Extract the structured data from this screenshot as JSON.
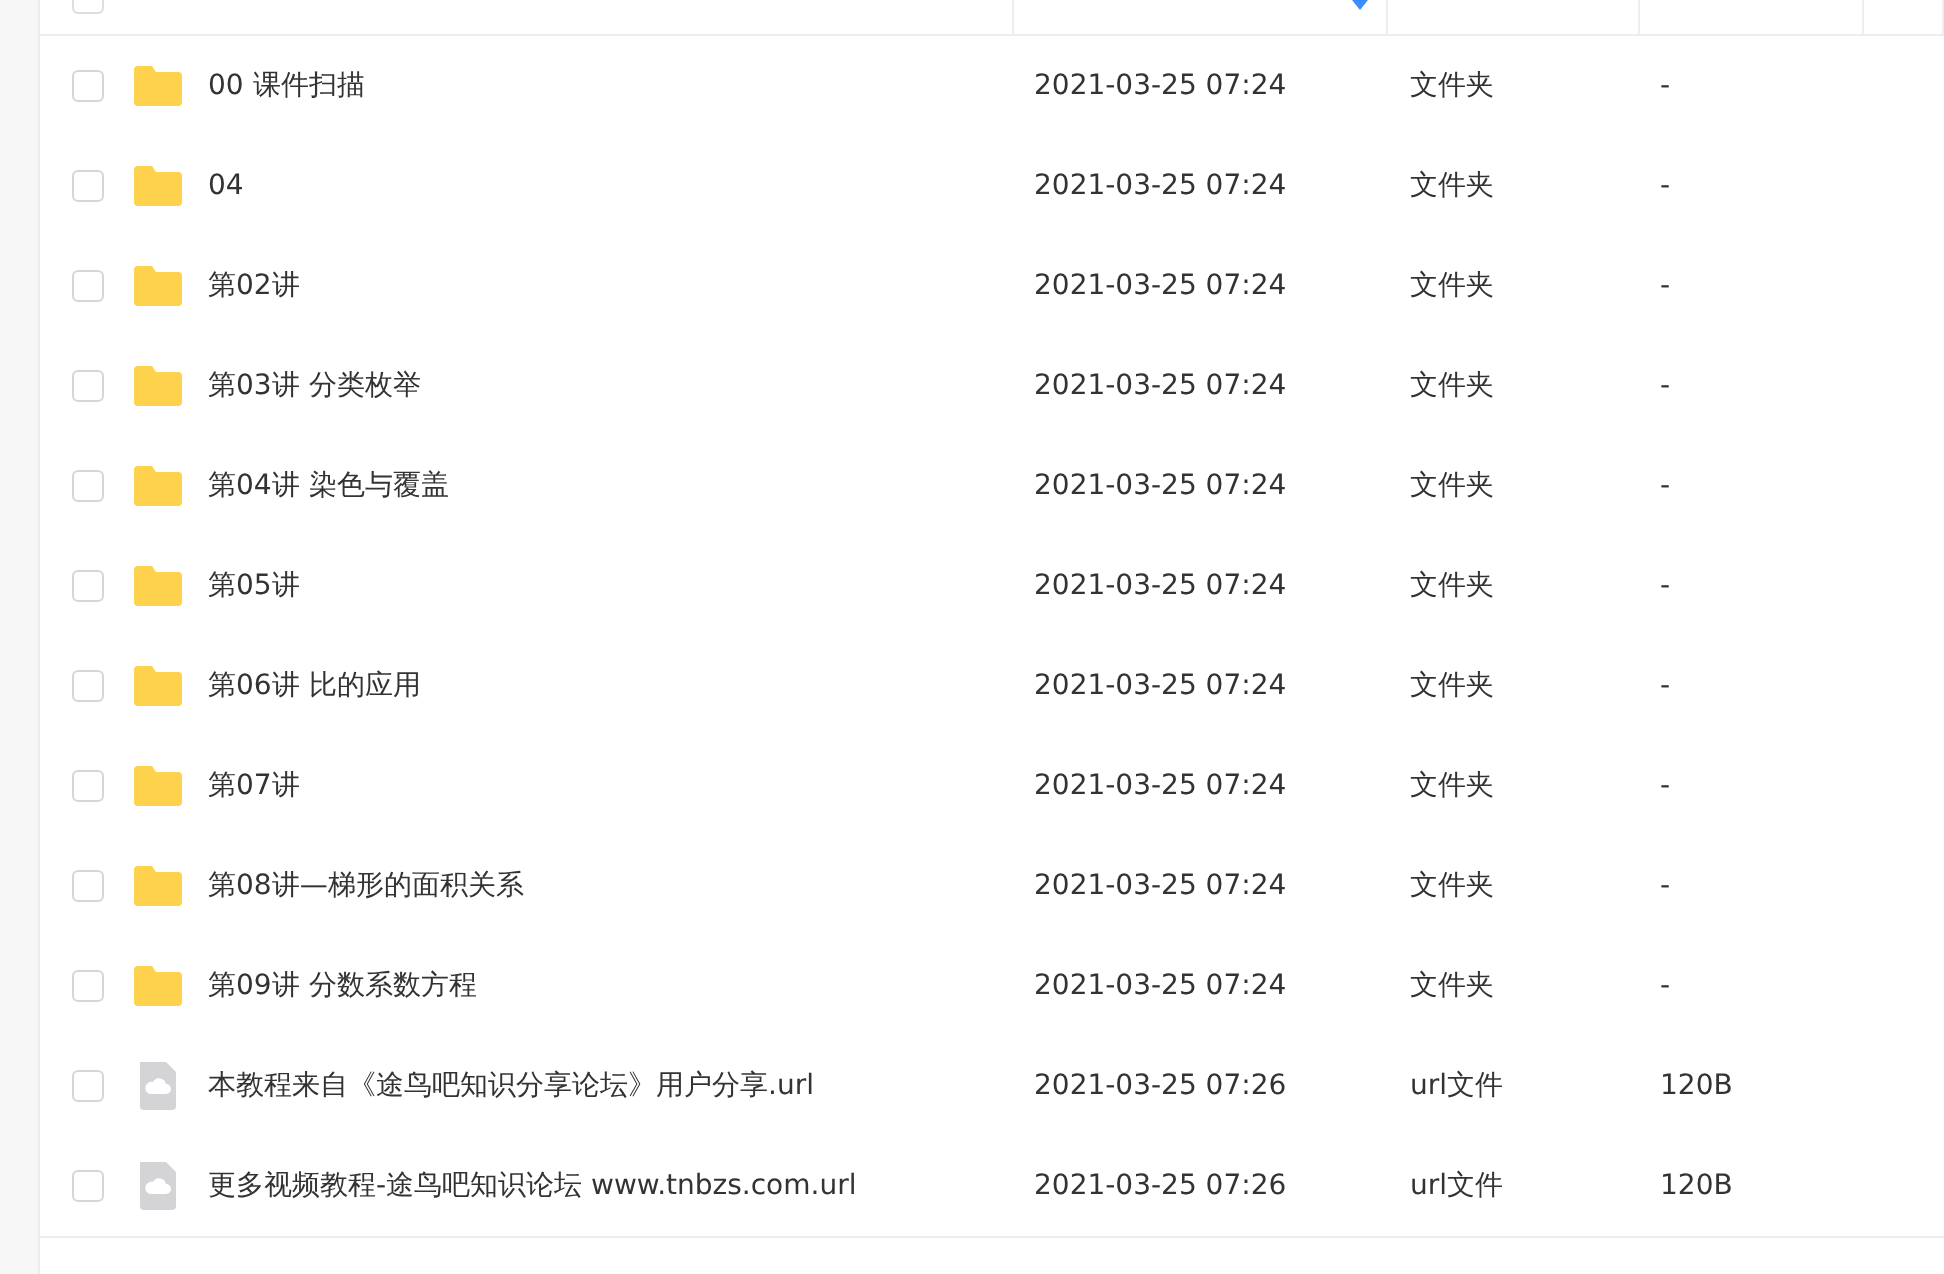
{
  "table": {
    "header": {
      "select_all_checked": false,
      "columns": [
        {
          "sorted": false
        },
        {
          "sorted": true
        },
        {
          "sorted": false
        },
        {
          "sorted": false
        },
        {
          "sorted": false
        }
      ]
    },
    "rows": [
      {
        "kind": "folder",
        "checked": false,
        "name": "00 课件扫描",
        "modified": "2021-03-25 07:24",
        "type": "文件夹",
        "size": "-"
      },
      {
        "kind": "folder",
        "checked": false,
        "name": "04",
        "modified": "2021-03-25 07:24",
        "type": "文件夹",
        "size": "-"
      },
      {
        "kind": "folder",
        "checked": false,
        "name": "第02讲",
        "modified": "2021-03-25 07:24",
        "type": "文件夹",
        "size": "-"
      },
      {
        "kind": "folder",
        "checked": false,
        "name": "第03讲 分类枚举",
        "modified": "2021-03-25 07:24",
        "type": "文件夹",
        "size": "-"
      },
      {
        "kind": "folder",
        "checked": false,
        "name": "第04讲 染色与覆盖",
        "modified": "2021-03-25 07:24",
        "type": "文件夹",
        "size": "-"
      },
      {
        "kind": "folder",
        "checked": false,
        "name": "第05讲",
        "modified": "2021-03-25 07:24",
        "type": "文件夹",
        "size": "-"
      },
      {
        "kind": "folder",
        "checked": false,
        "name": "第06讲 比的应用",
        "modified": "2021-03-25 07:24",
        "type": "文件夹",
        "size": "-"
      },
      {
        "kind": "folder",
        "checked": false,
        "name": "第07讲",
        "modified": "2021-03-25 07:24",
        "type": "文件夹",
        "size": "-"
      },
      {
        "kind": "folder",
        "checked": false,
        "name": "第08讲—梯形的面积关系",
        "modified": "2021-03-25 07:24",
        "type": "文件夹",
        "size": "-"
      },
      {
        "kind": "folder",
        "checked": false,
        "name": "第09讲 分数系数方程",
        "modified": "2021-03-25 07:24",
        "type": "文件夹",
        "size": "-"
      },
      {
        "kind": "file",
        "checked": false,
        "name": "本教程来自《途鸟吧知识分享论坛》用户分享.url",
        "modified": "2021-03-25 07:26",
        "type": "url文件",
        "size": "120B"
      },
      {
        "kind": "file",
        "checked": false,
        "name": "更多视频教程-途鸟吧知识论坛 www.tnbzs.com.url",
        "modified": "2021-03-25 07:26",
        "type": "url文件",
        "size": "120B"
      }
    ]
  }
}
